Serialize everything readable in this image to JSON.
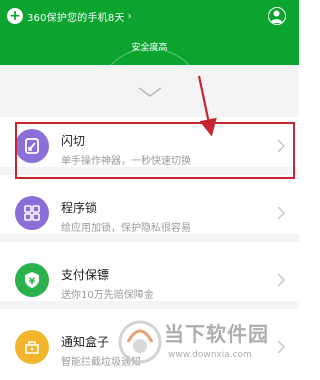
{
  "header": {
    "days_text": "360保护您的手机8天",
    "chevron": "›",
    "plus": "+",
    "safety_label": "安全度高",
    "bg_color": "#0aa42f"
  },
  "items": [
    {
      "title": "闪切",
      "desc": "单手操作神器，一秒快速切换",
      "icon": "flash-switch-icon",
      "color": "#8a6fd8"
    },
    {
      "title": "程序锁",
      "desc": "给应用加锁，保护隐私很容易",
      "icon": "grid-icon",
      "color": "#8a6fd8"
    },
    {
      "title": "支付保镖",
      "desc": "送你10万先赔保障金",
      "icon": "yen-shield-icon",
      "color": "#2bb24c"
    },
    {
      "title": "通知盒子",
      "desc": "智能拦截垃圾通知",
      "icon": "notification-box-icon",
      "color": "#f2b52b"
    }
  ],
  "watermark": {
    "title": "当下软件园",
    "url": "www.downxia.com"
  },
  "highlight_color": "#c8262f"
}
